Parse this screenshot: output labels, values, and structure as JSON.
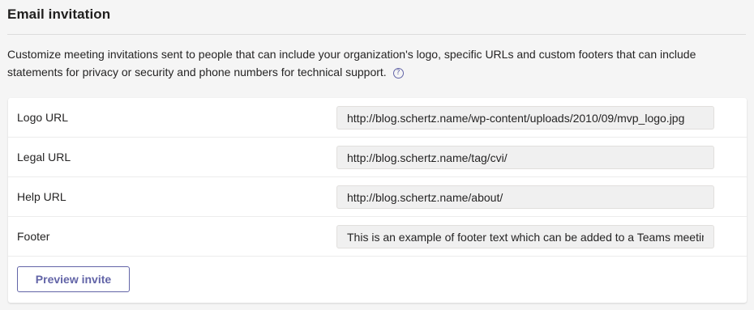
{
  "section": {
    "title": "Email invitation",
    "description": "Customize meeting invitations sent to people that can include your organization's logo, specific URLs and custom footers that can include statements for privacy or security and phone numbers for technical support.",
    "help_icon": "?"
  },
  "fields": [
    {
      "label": "Logo URL",
      "value": "http://blog.schertz.name/wp-content/uploads/2010/09/mvp_logo.jpg"
    },
    {
      "label": "Legal URL",
      "value": "http://blog.schertz.name/tag/cvi/"
    },
    {
      "label": "Help URL",
      "value": "http://blog.schertz.name/about/"
    },
    {
      "label": "Footer",
      "value": "This is an example of footer text which can be added to a Teams meeting invite."
    }
  ],
  "actions": {
    "preview_label": "Preview invite"
  },
  "colors": {
    "accent": "#6264a7",
    "field_background": "#f0f0f0",
    "page_background": "#f5f5f5"
  },
  "icons": {
    "help": "help-circle-icon"
  }
}
